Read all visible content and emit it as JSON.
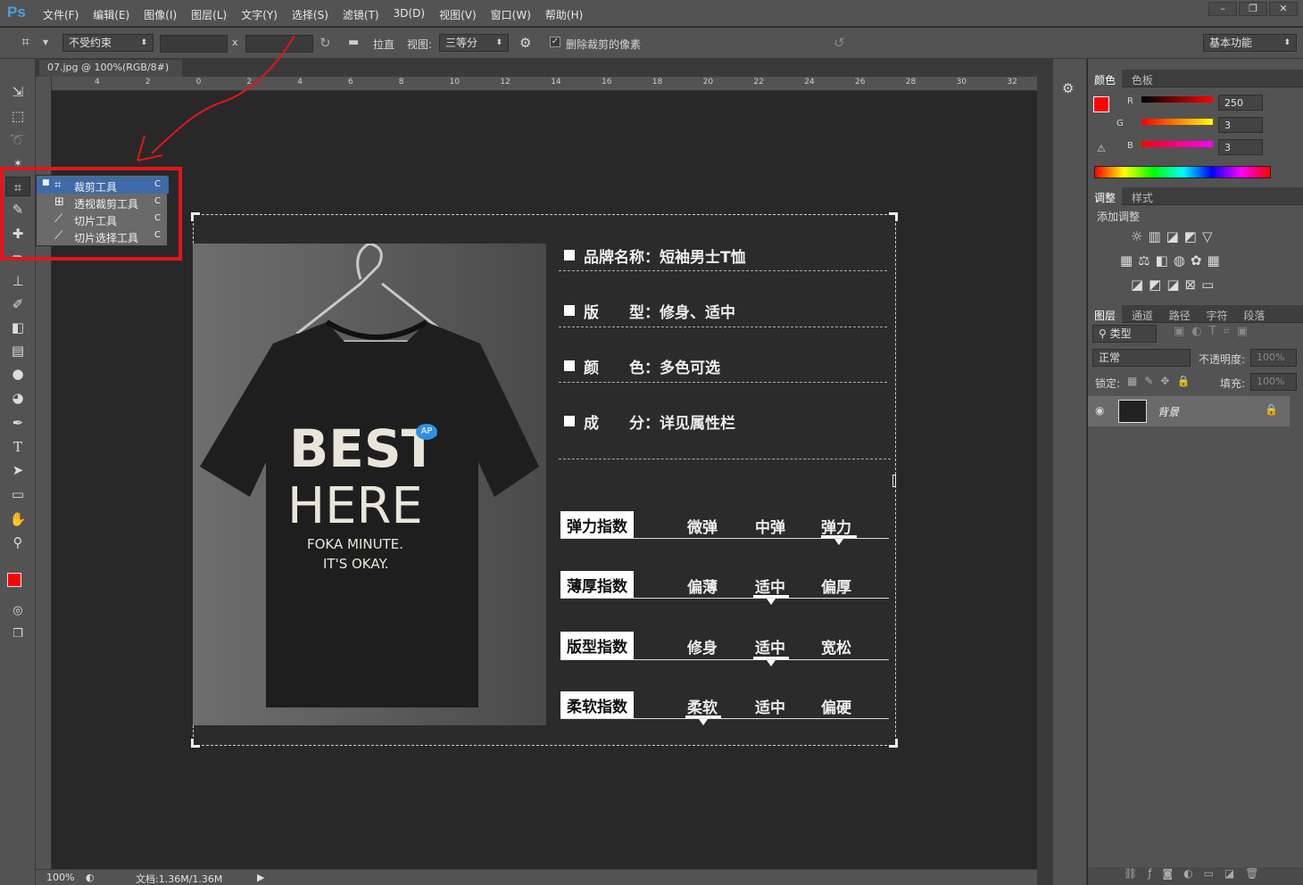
{
  "app": {
    "logo": "Ps"
  },
  "menu": [
    "文件(F)",
    "编辑(E)",
    "图像(I)",
    "图层(L)",
    "文字(Y)",
    "选择(S)",
    "滤镜(T)",
    "3D(D)",
    "视图(V)",
    "窗口(W)",
    "帮助(H)"
  ],
  "window_buttons": [
    "–",
    "❐",
    "✕"
  ],
  "options": {
    "ratio_select": "不受约束",
    "x_sep": "x",
    "straighten": "拉直",
    "view_label": "视图:",
    "view_select": "三等分",
    "delete_pixels": "删除裁剪的像素",
    "workspace": "基本功能"
  },
  "tab": {
    "title": "07.jpg @ 100%(RGB/8#)",
    "close": "×"
  },
  "ruler": {
    "h_ticks": [
      "4",
      "2",
      "0",
      "2",
      "4",
      "6",
      "8",
      "10",
      "12",
      "14",
      "16",
      "18",
      "20",
      "22",
      "24",
      "26",
      "28",
      "30",
      "32"
    ]
  },
  "crop_menu": {
    "items": [
      {
        "label": "裁剪工具",
        "key": "C"
      },
      {
        "label": "透视裁剪工具",
        "key": "C"
      },
      {
        "label": "切片工具",
        "key": "C"
      },
      {
        "label": "切片选择工具",
        "key": "C"
      }
    ]
  },
  "document": {
    "shirt": {
      "line1": "BEST",
      "line2": "HERE",
      "line3": "FOKA MINUTE.",
      "line4": "IT'S OKAY.",
      "badge": "AP"
    },
    "specs": [
      {
        "label": "品牌名称：短袖男士T恤"
      },
      {
        "label": "版　　型：修身、适中"
      },
      {
        "label": "颜　　色：多色可选"
      },
      {
        "label": "成　　分：详见属性栏"
      }
    ],
    "indexes": [
      {
        "tag": "弹力指数",
        "opts": [
          "微弹",
          "中弹",
          "弹力"
        ]
      },
      {
        "tag": "薄厚指数",
        "opts": [
          "偏薄",
          "适中",
          "偏厚"
        ]
      },
      {
        "tag": "版型指数",
        "opts": [
          "修身",
          "适中",
          "宽松"
        ]
      },
      {
        "tag": "柔软指数",
        "opts": [
          "柔软",
          "适中",
          "偏硬"
        ]
      }
    ]
  },
  "status": {
    "zoom": "100%",
    "doc": "文档:1.36M/1.36M"
  },
  "panels": {
    "color_tabs": [
      "颜色",
      "色板"
    ],
    "rgb": {
      "r_label": "R",
      "g_label": "G",
      "b_label": "B",
      "r": "250",
      "g": "3",
      "b": "3"
    },
    "adj_tabs": [
      "调整",
      "样式"
    ],
    "adj_title": "添加调整",
    "layer_tabs": [
      "图层",
      "通道",
      "路径",
      "字符",
      "段落"
    ],
    "filter": "类型",
    "blend": "正常",
    "opacity_label": "不透明度:",
    "opacity": "100%",
    "lock_label": "锁定:",
    "fill_label": "填充:",
    "fill": "100%",
    "layer_name": "背景"
  },
  "colors": {
    "fg": "#fa0303",
    "bg": "#1ec8c8",
    "accent": "#e4141a"
  }
}
